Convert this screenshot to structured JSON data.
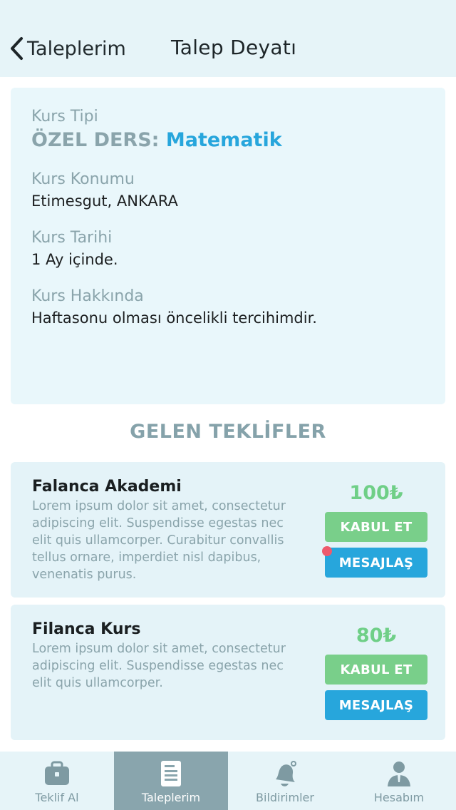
{
  "nav": {
    "back_label": "Taleplerim",
    "title": "Talep Deyatı"
  },
  "detail": {
    "type_label": "Kurs Tipi",
    "type_prefix": "ÖZEL DERS:",
    "type_subject": "Matematik",
    "location_label": "Kurs Konumu",
    "location_value": "Etimesgut, ANKARA",
    "date_label": "Kurs Tarihi",
    "date_value": "1 Ay içinde.",
    "about_label": "Kurs Hakkında",
    "about_value": "Haftasonu olması öncelikli tercihimdir."
  },
  "offers_title": "GELEN TEKLİFLER",
  "offers": [
    {
      "name": "Falanca Akademi",
      "description": "Lorem ipsum dolor sit amet, consectetur adipiscing elit. Suspendisse egestas nec elit quis ullamcorper. Curabitur convallis tellus ornare, imperdiet nisl dapibus, venenatis purus.",
      "price": "100₺",
      "accept_label": "KABUL ET",
      "message_label": "MESAJLAŞ",
      "has_notification": true
    },
    {
      "name": "Filanca Kurs",
      "description": "Lorem ipsum dolor sit amet, consectetur adipiscing elit. Suspendisse egestas nec elit quis ullamcorper.",
      "price": "80₺",
      "accept_label": "KABUL ET",
      "message_label": "MESAJLAŞ",
      "has_notification": false
    }
  ],
  "tabs": [
    {
      "label": "Teklif Al",
      "icon": "briefcase-icon",
      "active": false
    },
    {
      "label": "Taleplerim",
      "icon": "document-icon",
      "active": true
    },
    {
      "label": "Bildirimler",
      "icon": "bell-icon",
      "active": false
    },
    {
      "label": "Hesabım",
      "icon": "user-icon",
      "active": false
    }
  ],
  "colors": {
    "accent_blue": "#27a6dc",
    "accent_green": "#79cf8a",
    "notification_red": "#ee5a6d",
    "active_tab": "#89a5ad"
  }
}
